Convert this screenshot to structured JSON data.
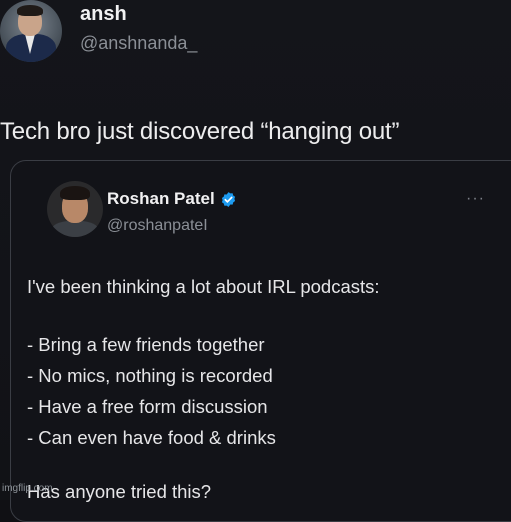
{
  "post": {
    "author_name": "ansh",
    "author_handle": "@anshnanda_",
    "text": "Tech bro just discovered “hanging out”"
  },
  "quote": {
    "author_name": "Roshan Patel",
    "author_handle": "@roshanpateI",
    "verified": true,
    "more_icon": "···",
    "intro": "I've been thinking a lot about IRL podcasts:",
    "bullets": [
      "- Bring a few friends together",
      "- No mics, nothing is recorded",
      "- Have a free form discussion",
      "- Can even have food & drinks"
    ],
    "question": "Has anyone tried this?"
  },
  "watermark": "imgflip.com",
  "colors": {
    "background": "#121318",
    "verified_badge": "#1d9bf0",
    "handle_text": "#8b8f96",
    "card_border": "#3a3d44"
  }
}
